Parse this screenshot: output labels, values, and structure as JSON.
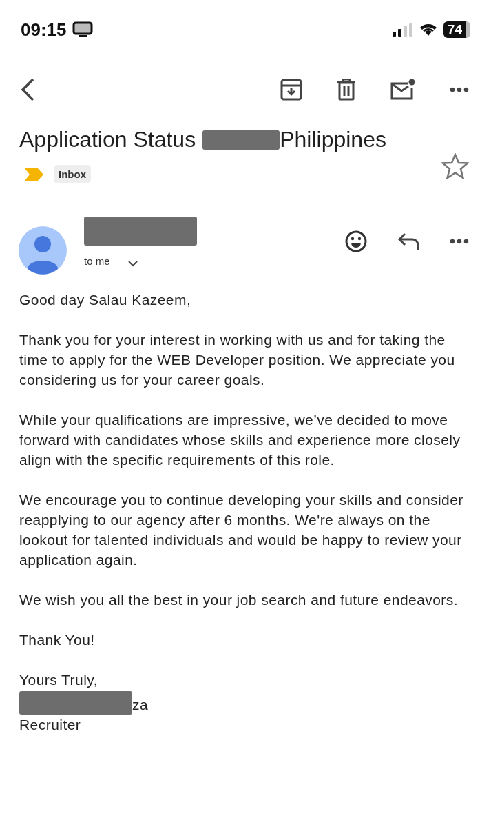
{
  "status_bar": {
    "time": "09:15",
    "battery": "74"
  },
  "subject": {
    "before": "Application Status",
    "redacted": true,
    "after": "Philippines",
    "starred": false
  },
  "labels": [
    {
      "text": "Inbox"
    }
  ],
  "sender": {
    "name_redacted": true,
    "recipient": "to me"
  },
  "body": [
    "Good day Salau Kazeem,",
    "Thank you for your interest in working with us and for taking the time to apply for the WEB Developer position. We appreciate you considering us for your career goals.",
    "While your qualifications are impressive, we’ve decided to move forward with candidates whose skills and experience more closely align with the specific requirements of this role.",
    "We encourage you to continue developing your skills and consider reapplying to our agency after 6 months. We're always on the lookout for talented individuals and would be happy to review your application again.",
    "We wish you all the best in your job search and future endeavors.",
    "Thank You!"
  ],
  "signature": {
    "closing": "Yours Truly,",
    "name_redacted": true,
    "name_tail": "za",
    "role": "Recruiter"
  }
}
